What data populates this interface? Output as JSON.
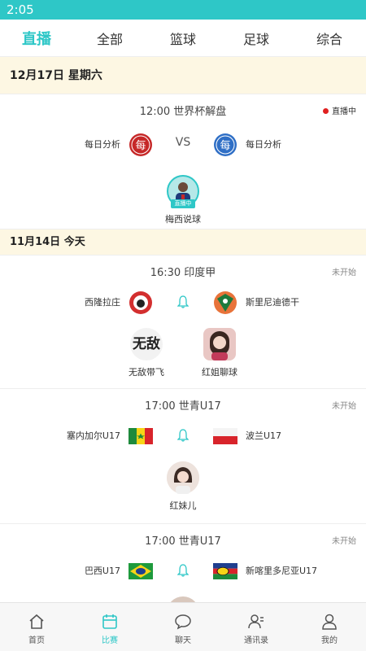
{
  "status_bar": {
    "time": "2:05"
  },
  "tabs": [
    "直播",
    "全部",
    "篮球",
    "足球",
    "综合"
  ],
  "sections": [
    {
      "date": "12月17日 星期六",
      "matches": [
        {
          "time_league": "12:00 世界杯解盘",
          "status": "直播中",
          "home": "每日分析",
          "away": "每日分析",
          "middle": "VS",
          "home_logo_char": "每",
          "away_logo_char": "每",
          "hosts": [
            {
              "name": "梅西说球",
              "live_tag": "直播中"
            }
          ]
        }
      ]
    },
    {
      "date": "11月14日   今天",
      "matches": [
        {
          "time_league": "16:30 印度甲",
          "status": "未开始",
          "home": "西隆拉庄",
          "away": "斯里尼迪德干",
          "hosts": [
            {
              "name": "无敌带飞",
              "avatar_text": "无敌"
            },
            {
              "name": "红姐聊球"
            }
          ]
        },
        {
          "time_league": "17:00 世青U17",
          "status": "未开始",
          "home": "塞内加尔U17",
          "away": "波兰U17",
          "hosts": [
            {
              "name": "红妹儿"
            }
          ]
        },
        {
          "time_league": "17:00 世青U17",
          "status": "未开始",
          "home": "巴西U17",
          "away": "新喀里多尼亚U17"
        }
      ]
    }
  ],
  "bottom_nav": [
    "首页",
    "比赛",
    "聊天",
    "通讯录",
    "我的"
  ],
  "colors": {
    "accent": "#2ec7c7",
    "live_dot": "#e02020",
    "date_bg": "#fdf7e3"
  }
}
